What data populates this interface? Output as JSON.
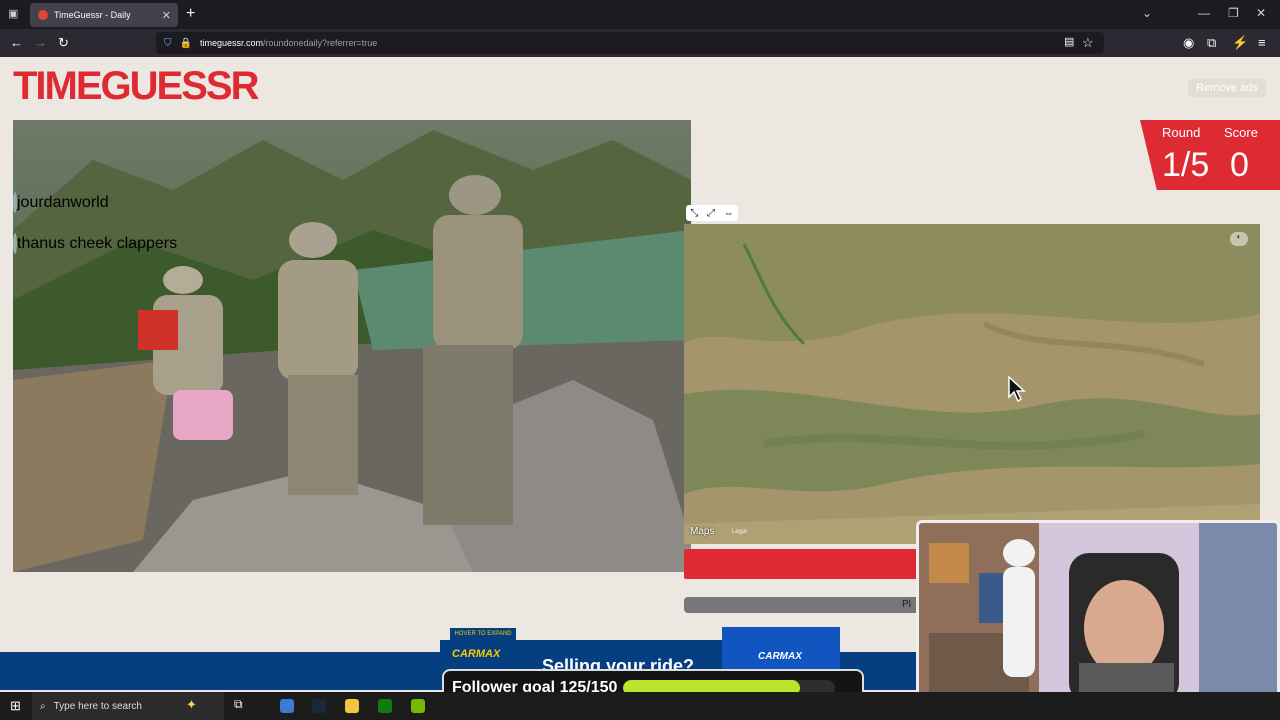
{
  "browser": {
    "tab_title": "TimeGuessr - Daily",
    "url_host": "timeguessr.com",
    "url_path": "/roundonedaily?referrer=true"
  },
  "page": {
    "logo": "TIMEGUESSR",
    "remove_ads": "Remove ads",
    "round_label": "Round",
    "round_value": "1/5",
    "score_label": "Score",
    "score_value": "0",
    "viewers": [
      {
        "name": "jourdanworld"
      },
      {
        "name": "thanus cheek clappers"
      }
    ],
    "map": {
      "attribution": "Maps",
      "legal": "Legal",
      "tools": [
        "⤡",
        "⤢",
        "⇔"
      ]
    },
    "progress_label": "Pl"
  },
  "ad": {
    "expand_label": "HOVER TO EXPAND",
    "brand": "CARMAX",
    "headline": "Selling your ride?"
  },
  "overlay": {
    "goal_label": "Follower goal 125/150",
    "goal_current": 125,
    "goal_total": 150
  },
  "taskbar": {
    "search_placeholder": "Type here to search"
  },
  "colors": {
    "brand_red": "#de2b33",
    "goal_green": "#b9e62a",
    "carmax_blue": "#063e82",
    "carmax_yellow": "#f6c900"
  }
}
